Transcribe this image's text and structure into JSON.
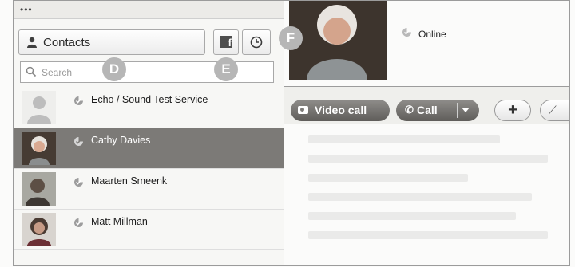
{
  "sidebar": {
    "contacts_label": "Contacts",
    "search_placeholder": "Search",
    "contacts": [
      {
        "name": "Echo / Sound Test Service",
        "selected": false,
        "avatar": "default-person-icon"
      },
      {
        "name": "Cathy Davies",
        "selected": true,
        "avatar": "photo"
      },
      {
        "name": "Maarten Smeenk",
        "selected": false,
        "avatar": "photo"
      },
      {
        "name": "Matt Millman",
        "selected": false,
        "avatar": "photo"
      }
    ]
  },
  "callouts": {
    "d": "D",
    "e": "E",
    "f": "F"
  },
  "profile": {
    "status": "Online"
  },
  "actions": {
    "video_call": "Video call",
    "call": "Call",
    "add": "+"
  },
  "colors": {
    "selected_row": "#7c7a77",
    "pill": "#6f6d6a",
    "callout": "#b6b6b6"
  }
}
